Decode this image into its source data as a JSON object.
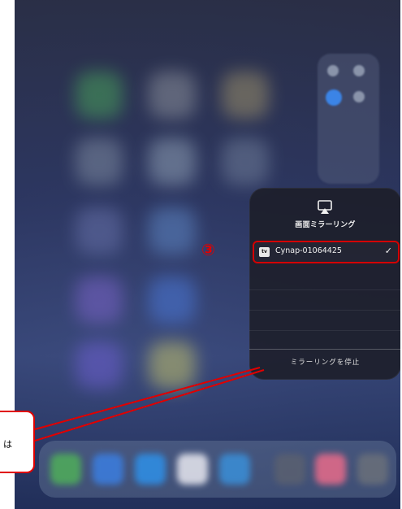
{
  "panel": {
    "title": "画面ミラーリング",
    "device_badge": "tv",
    "device_name": "Cynap-01064425",
    "check_glyph": "✓",
    "stop_label": "ミラーリングを停止",
    "airplay_icon": "airplay-screen-icon"
  },
  "annotation": {
    "step": "③",
    "callout_text": "は",
    "color": "#e00000"
  }
}
